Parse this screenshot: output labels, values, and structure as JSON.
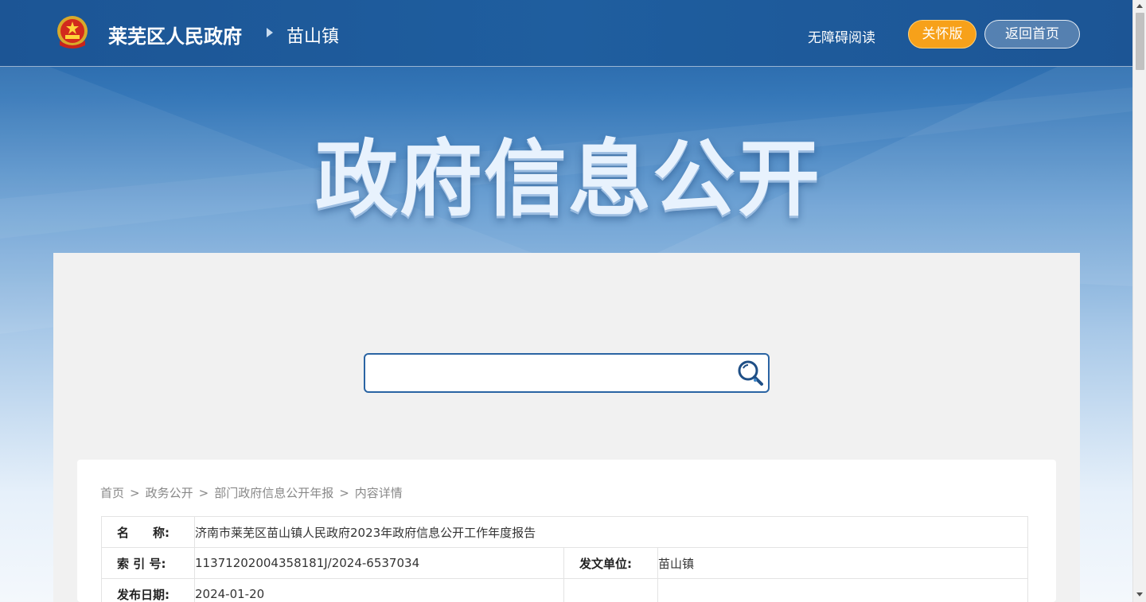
{
  "header": {
    "site_name": "莱芜区人民政府",
    "sub_name": "苗山镇",
    "accessible_label": "无障碍阅读",
    "care_label": "关怀版",
    "home_label": "返回首页"
  },
  "banner": {
    "title": "政府信息公开"
  },
  "search": {
    "value": "",
    "placeholder": ""
  },
  "breadcrumb": {
    "items": [
      "首页",
      "政务公开",
      "部门政府信息公开年报",
      "内容详情"
    ],
    "separator": ">"
  },
  "info": {
    "name_label": "名　　称:",
    "name_value": "济南市莱芜区苗山镇人民政府2023年政府信息公开工作年度报告",
    "index_label": "索 引 号:",
    "index_value": "11371202004358181J/2024-6537034",
    "issuer_label": "发文单位:",
    "issuer_value": "苗山镇",
    "date_label": "发布日期:",
    "date_value": "2024-01-20"
  },
  "colors": {
    "header_bg": "#1c5595",
    "care_btn": "#f7a11a",
    "search_border": "#2a64a3",
    "panel_bg": "#f1f1f1"
  },
  "icons": {
    "emblem": "national-emblem-icon",
    "search": "search-icon"
  }
}
